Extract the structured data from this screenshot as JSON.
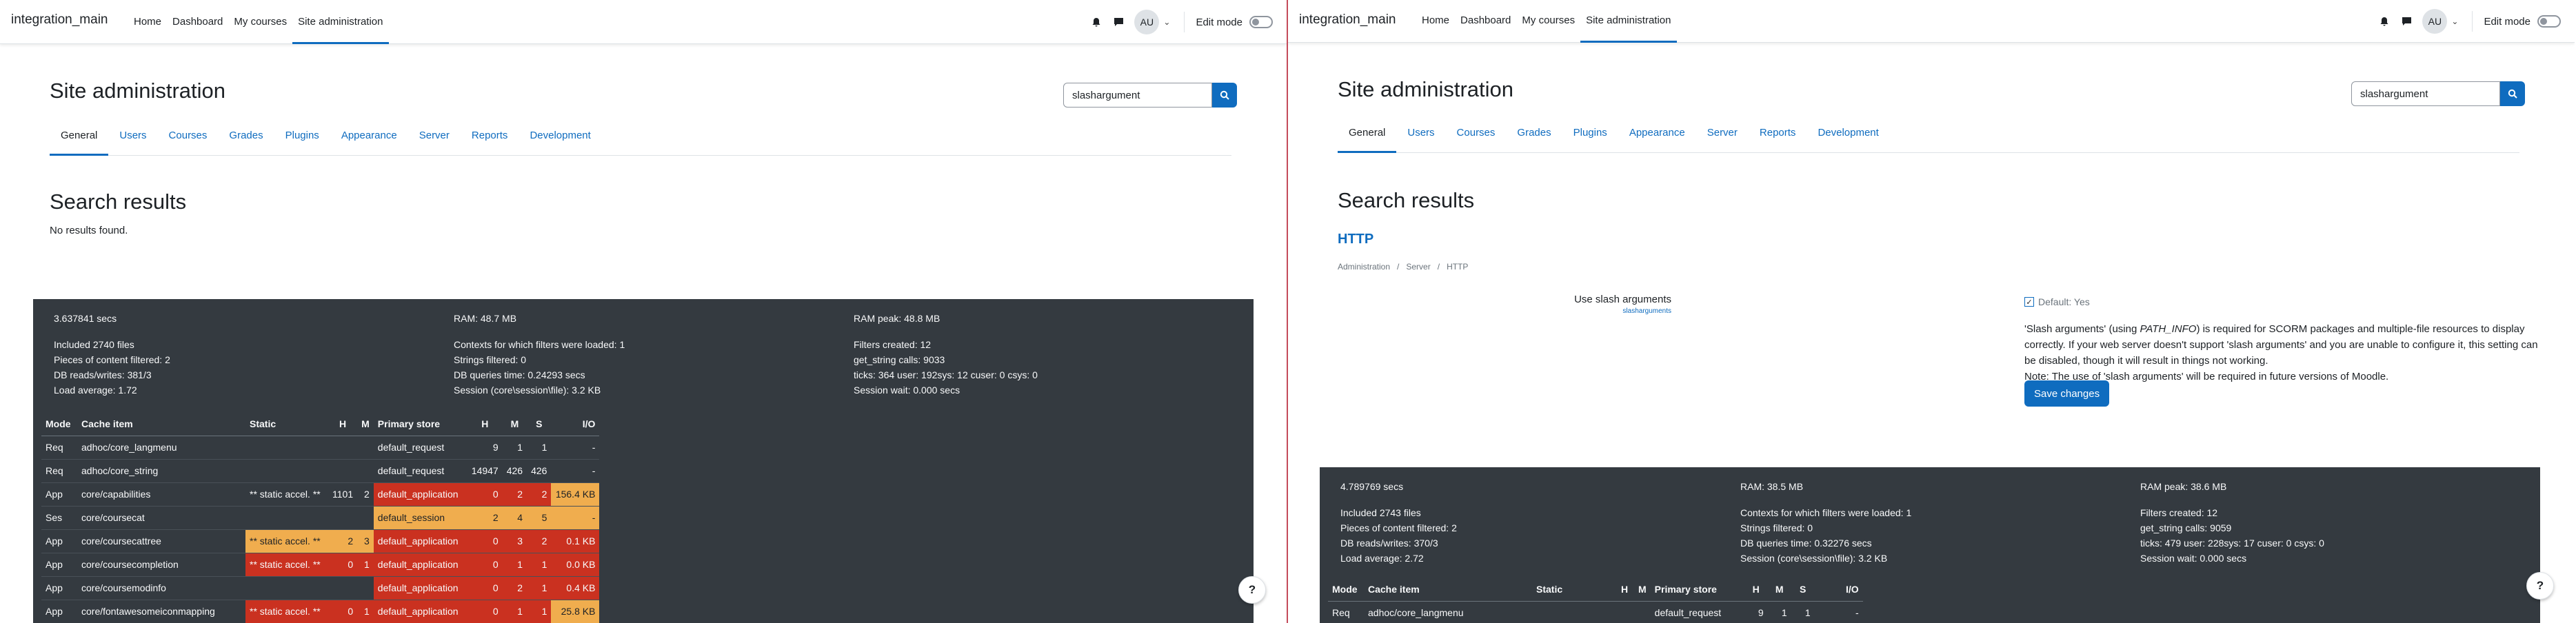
{
  "left": {
    "navbar": {
      "brand": "integration_main",
      "links": [
        "Home",
        "Dashboard",
        "My courses",
        "Site administration"
      ],
      "avatar": "AU",
      "edit_mode": "Edit mode"
    },
    "page_title": "Site administration",
    "search": {
      "value": "slashargument"
    },
    "tabs": [
      "General",
      "Users",
      "Courses",
      "Grades",
      "Plugins",
      "Appearance",
      "Server",
      "Reports",
      "Development"
    ],
    "results_heading": "Search results",
    "no_results": "No results found.",
    "perf": {
      "col1": [
        "3.637841 secs",
        "Included 2740 files",
        "Pieces of content filtered: 2",
        "DB reads/writes: 381/3",
        "Load average: 1.72"
      ],
      "col2": [
        "RAM: 48.7 MB",
        "Contexts for which filters were loaded: 1",
        "Strings filtered: 0",
        "DB queries time: 0.24293 secs",
        "Session (core\\session\\file): 3.2 KB"
      ],
      "col3": [
        "RAM peak: 48.8 MB",
        "Filters created: 12",
        "get_string calls: 9033",
        "ticks: 364 user: 192sys: 12 cuser: 0 csys: 0",
        "Session wait: 0.000 secs"
      ],
      "headers": [
        "Mode",
        "Cache item",
        "Static",
        "H",
        "M",
        "Primary store",
        "H",
        "M",
        "S",
        "I/O"
      ],
      "rows": [
        [
          "Req",
          "adhoc/core_langmenu",
          "",
          "",
          "",
          "default_request",
          "9",
          "1",
          "1",
          "-"
        ],
        [
          "Req",
          "adhoc/core_string",
          "",
          "",
          "",
          "default_request",
          "14947",
          "426",
          "426",
          "-"
        ],
        [
          "App",
          "core/capabilities",
          "** static accel. **",
          "1101",
          "2",
          "default_application",
          "0",
          "2",
          "2",
          "156.4 KB"
        ],
        [
          "Ses",
          "core/coursecat",
          "",
          "",
          "",
          "default_session",
          "2",
          "4",
          "5",
          "-"
        ],
        [
          "App",
          "core/coursecattree",
          "** static accel. **",
          "2",
          "3",
          "default_application",
          "0",
          "3",
          "2",
          "0.1 KB"
        ],
        [
          "App",
          "core/coursecompletion",
          "** static accel. **",
          "0",
          "1",
          "default_application",
          "0",
          "1",
          "1",
          "0.0 KB"
        ],
        [
          "App",
          "core/coursemodinfo",
          "",
          "",
          "",
          "default_application",
          "0",
          "2",
          "1",
          "0.4 KB"
        ],
        [
          "App",
          "core/fontawesomeiconmapping",
          "** static accel. **",
          "0",
          "1",
          "default_application",
          "0",
          "1",
          "1",
          "25.8 KB"
        ]
      ]
    },
    "help": "?"
  },
  "right": {
    "navbar": {
      "brand": "integration_main",
      "links": [
        "Home",
        "Dashboard",
        "My courses",
        "Site administration"
      ],
      "avatar": "AU",
      "edit_mode": "Edit mode"
    },
    "page_title": "Site administration",
    "search": {
      "value": "slashargument"
    },
    "tabs": [
      "General",
      "Users",
      "Courses",
      "Grades",
      "Plugins",
      "Appearance",
      "Server",
      "Reports",
      "Development"
    ],
    "results_heading": "Search results",
    "section": "HTTP",
    "breadcrumb": [
      "Administration",
      "/",
      "Server",
      "/",
      "HTTP"
    ],
    "setting": {
      "label": "Use slash arguments",
      "name": "slasharguments",
      "default": "Default: Yes",
      "desc_1a": "'Slash arguments' (using ",
      "desc_1b": "PATH_INFO",
      "desc_1c": ") is required for SCORM packages and multiple-file resources to display correctly. If your web server doesn't support 'slash arguments' and you are unable to configure it, this setting can be disabled, though it will result in things not working.",
      "desc_2": "Note: The use of 'slash arguments' will be required in future versions of Moodle.",
      "save": "Save changes"
    },
    "perf": {
      "col1": [
        "4.789769 secs",
        "Included 2743 files",
        "Pieces of content filtered: 2",
        "DB reads/writes: 370/3",
        "Load average: 2.72"
      ],
      "col2": [
        "RAM: 38.5 MB",
        "Contexts for which filters were loaded: 1",
        "Strings filtered: 0",
        "DB queries time: 0.32276 secs",
        "Session (core\\session\\file): 3.2 KB"
      ],
      "col3": [
        "RAM peak: 38.6 MB",
        "Filters created: 12",
        "get_string calls: 9059",
        "ticks: 479 user: 228sys: 17 cuser: 0 csys: 0",
        "Session wait: 0.000 secs"
      ],
      "headers": [
        "Mode",
        "Cache item",
        "Static",
        "H",
        "M",
        "Primary store",
        "H",
        "M",
        "S",
        "I/O"
      ],
      "rows": [
        [
          "Req",
          "adhoc/core_langmenu",
          "",
          "",
          "",
          "default_request",
          "9",
          "1",
          "1",
          "-"
        ]
      ]
    },
    "help": "?"
  },
  "colors": {
    "accent": "#0f6cbf",
    "perf_bg": "#343a40",
    "red": "#ca3120",
    "amber": "#f0ad4e"
  }
}
